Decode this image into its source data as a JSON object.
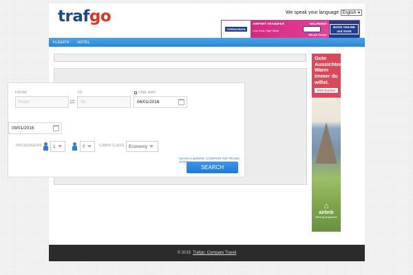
{
  "header": {
    "logo_part1": "traf",
    "logo_part2": "go",
    "language_label": "We speak your language",
    "language_value": "English"
  },
  "banner": {
    "brand": "TERRAVISION",
    "title": "AIRPORT TRANSFER",
    "tagline": "Low Cost, High Value",
    "airport": "MALPENSA",
    "city": "MILAN Centre",
    "cta": "BOOK ONLINE and SAVE"
  },
  "nav": {
    "items": [
      "FLIGHTS",
      "HOTEL"
    ]
  },
  "search": {
    "from_label": "FROM",
    "from_placeholder": "From",
    "to_label": "TO",
    "to_placeholder": "To",
    "one_way_label": "ONE WAY",
    "depart_date": "06/01/2016",
    "return_date": "09/01/2016",
    "passengers_label": "PASSENGERS",
    "adults": "1",
    "children": "0",
    "cabin_label": "CABIN CLASS",
    "cabin_value": "Economy",
    "promo": "SEARCH &MORE. COMPARE 700 TRAVEL SITES!",
    "button": "SEARCH"
  },
  "ad": {
    "headline": "Gute Aussichten. Wann immer du willst.",
    "button": "Jetzt buchen",
    "brand": "airbnb",
    "slogan": "Belong Anywhere"
  },
  "footer": {
    "copyright": "© 2015",
    "link": "Trafgo: Compare Travel"
  }
}
